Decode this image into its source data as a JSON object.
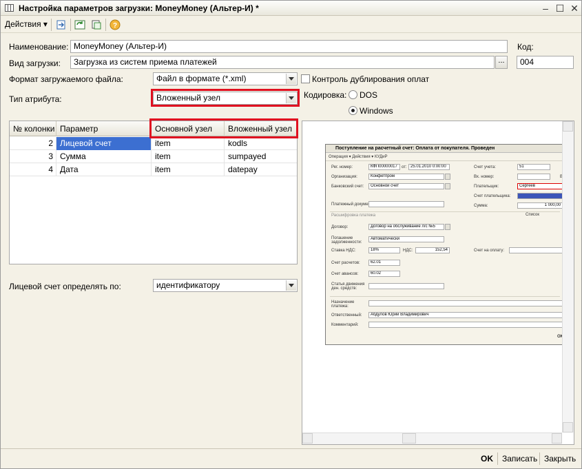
{
  "window": {
    "title": "Настройка параметров загрузки: MoneyMoney (Альтер-И) *",
    "controls": [
      "‒",
      "☐",
      "✕"
    ]
  },
  "toolbar": {
    "actions_label": "Действия ▾",
    "help_glyph": "?"
  },
  "form": {
    "name_label": "Наименование:",
    "name_value": "MoneyMoney (Альтер-И)",
    "code_label": "Код:",
    "code_value": "004",
    "load_type_label": "Вид загрузки:",
    "load_type_value": "Загрузка из систем приема платежей",
    "file_format_label": "Формат загружаемого файла:",
    "file_format_value": "Файл в формате (*.xml)",
    "dup_control_label": "Контроль дублирования оплат",
    "attr_type_label": "Тип атрибута:",
    "attr_type_value": "Вложенный узел",
    "encoding_label": "Кодировка:",
    "encoding_options": [
      "DOS",
      "Windows"
    ],
    "encoding_selected": "Windows",
    "account_by_label": "Лицевой счет определять по:",
    "account_by_value": "идентификатору",
    "dots": "..."
  },
  "grid": {
    "columns": [
      "№ колонки",
      "Параметр",
      "Основной узел",
      "Вложенный узел"
    ],
    "rows": [
      {
        "num": "2",
        "param": "Лицевой счет",
        "main": "item",
        "nested": "kodls"
      },
      {
        "num": "3",
        "param": "Сумма",
        "main": "item",
        "nested": "sumpayed"
      },
      {
        "num": "4",
        "param": "Дата",
        "main": "item",
        "nested": "datepay"
      }
    ]
  },
  "preview": {
    "title": "Поступление на расчетный счет: Оплата от покупателя. Проведен",
    "toolbar": "Операция ▾   Действия ▾   КУДиР",
    "labels": {
      "reg_num": "Рег. номер:",
      "from": "от:",
      "org": "Организация:",
      "bank_acc": "Банковский счет:",
      "pay_doc": "Платежный документ:",
      "decode": "Расшифровка платежа",
      "contract": "Договор:",
      "debt": "Погашение задолженности:",
      "vat_rate": "Ставка НДС:",
      "vat": "НДС:",
      "settle_acc": "Счет расчетов:",
      "adv_acc": "Счет авансов:",
      "cash_item": "Статья движения ден. средств:",
      "purpose": "Назначение платежа:",
      "responsible": "Ответственный:",
      "comment": "Комментарий:",
      "acc_account": "Счет учета:",
      "in_num": "Вх. номер:",
      "payer": "Плательщик:",
      "payer_acc": "Счет плательщика:",
      "sum": "Сумма:",
      "list": "Список",
      "pay_acc": "Счет на оплату:",
      "in_from": "В",
      "ok": "ОК"
    },
    "values": {
      "reg_num": "КФП00000017",
      "date": "25.01.2010 0:00:00",
      "org": "Конфетпром",
      "bank_acc": "Основной счет",
      "contract": "Договор на обслуживание л/с №5",
      "debt": "Автоматически",
      "vat_rate": "18%",
      "vat": "152,54",
      "settle_acc": "62.01",
      "adv_acc": "60.02",
      "responsible": "Абдулов Юрий Владимирович",
      "acc_account": "51",
      "payer": "Сергеев",
      "sum": "1 000,00"
    }
  },
  "footer": {
    "ok": "OK",
    "save": "Записать",
    "close": "Закрыть"
  },
  "colors": {
    "highlight": "#e01020",
    "selection": "#3c6fd1",
    "window_bg": "#f4f1e6"
  }
}
